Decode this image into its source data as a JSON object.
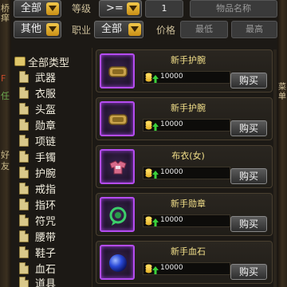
{
  "filters": {
    "category_select": "全部",
    "level_label": "等级",
    "operator_select": ">=",
    "level_value": "1",
    "item_name_placeholder": "物品名称",
    "type_select": "其他",
    "job_label": "职业",
    "job_select": "全部",
    "price_label": "价格",
    "price_min_placeholder": "最低",
    "price_max_placeholder": "最高"
  },
  "tree": {
    "root_label": "全部类型",
    "items": [
      "武器",
      "衣服",
      "头盔",
      "勋章",
      "项链",
      "手镯",
      "护腕",
      "戒指",
      "指环",
      "符咒",
      "腰带",
      "鞋子",
      "血石",
      "道具"
    ]
  },
  "listings": [
    {
      "name": "新手护腕",
      "price": "10000",
      "buy": "购买",
      "icon": "bracer-icon"
    },
    {
      "name": "新手护腕",
      "price": "10000",
      "buy": "购买",
      "icon": "bracer-icon"
    },
    {
      "name": "布衣(女)",
      "price": "10000",
      "buy": "购买",
      "icon": "cloth-armor-icon"
    },
    {
      "name": "新手勋章",
      "price": "10000",
      "buy": "购买",
      "icon": "medal-icon"
    },
    {
      "name": "新手血石",
      "price": "10000",
      "buy": "购买",
      "icon": "bloodstone-icon"
    }
  ],
  "colors": {
    "accent_gold": "#f3e08a",
    "rarity_purple": "#b44cf0",
    "dropdown_arrow": "#e0a82a"
  }
}
